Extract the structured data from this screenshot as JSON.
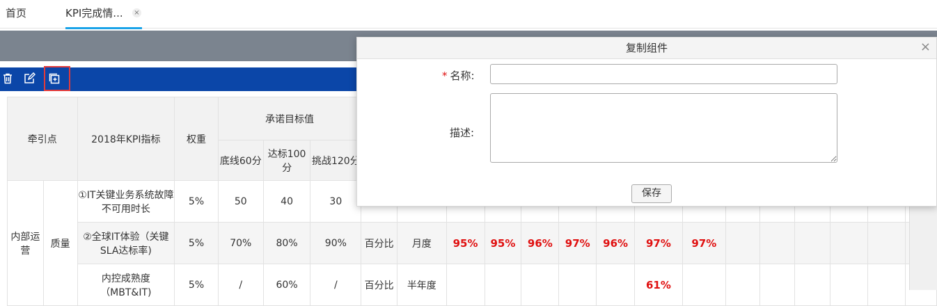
{
  "tabs": {
    "home": "首页",
    "active": "KPI完成情...",
    "close_glyph": "×"
  },
  "toolbar": {
    "icons": [
      "trash-icon",
      "edit-icon",
      "copy-add-icon"
    ]
  },
  "table": {
    "headers": {
      "traction": "牵引点",
      "kpi": "2018年KPI指标",
      "weight": "权重",
      "target": "承诺目标值",
      "base": "底线60分",
      "standard": "达标100分",
      "challenge": "挑战120分"
    },
    "group": {
      "dept": "内部运营",
      "category": "质量"
    },
    "rows": [
      {
        "name": "①IT关键业务系统故障不可用时长",
        "weight": "5%",
        "base": "50",
        "standard": "40",
        "challenge": "30",
        "unit": "",
        "period": "",
        "values": [
          "",
          "",
          "",
          "",
          "",
          "",
          "",
          "",
          "",
          "",
          "",
          "",
          ""
        ]
      },
      {
        "name": "②全球IT体验（关键SLA达标率)",
        "weight": "5%",
        "base": "70%",
        "standard": "80%",
        "challenge": "90%",
        "unit": "百分比",
        "period": "月度",
        "values": [
          "95%",
          "95%",
          "96%",
          "97%",
          "96%",
          "97%",
          "97%",
          "",
          "",
          "",
          "",
          "",
          ""
        ]
      },
      {
        "name": "内控成熟度（MBT&IT)",
        "weight": "5%",
        "base": "/",
        "standard": "60%",
        "challenge": "/",
        "unit": "百分比",
        "period": "半年度",
        "values": [
          "",
          "",
          "",
          "",
          "",
          "61%",
          "",
          "",
          "",
          "",
          "",
          "",
          ""
        ]
      }
    ]
  },
  "dialog": {
    "title": "复制组件",
    "close_glyph": "×",
    "name_label": "名称:",
    "required_mark": "*",
    "desc_label": "描述:",
    "name_value": "",
    "desc_value": "",
    "save_label": "保存"
  }
}
